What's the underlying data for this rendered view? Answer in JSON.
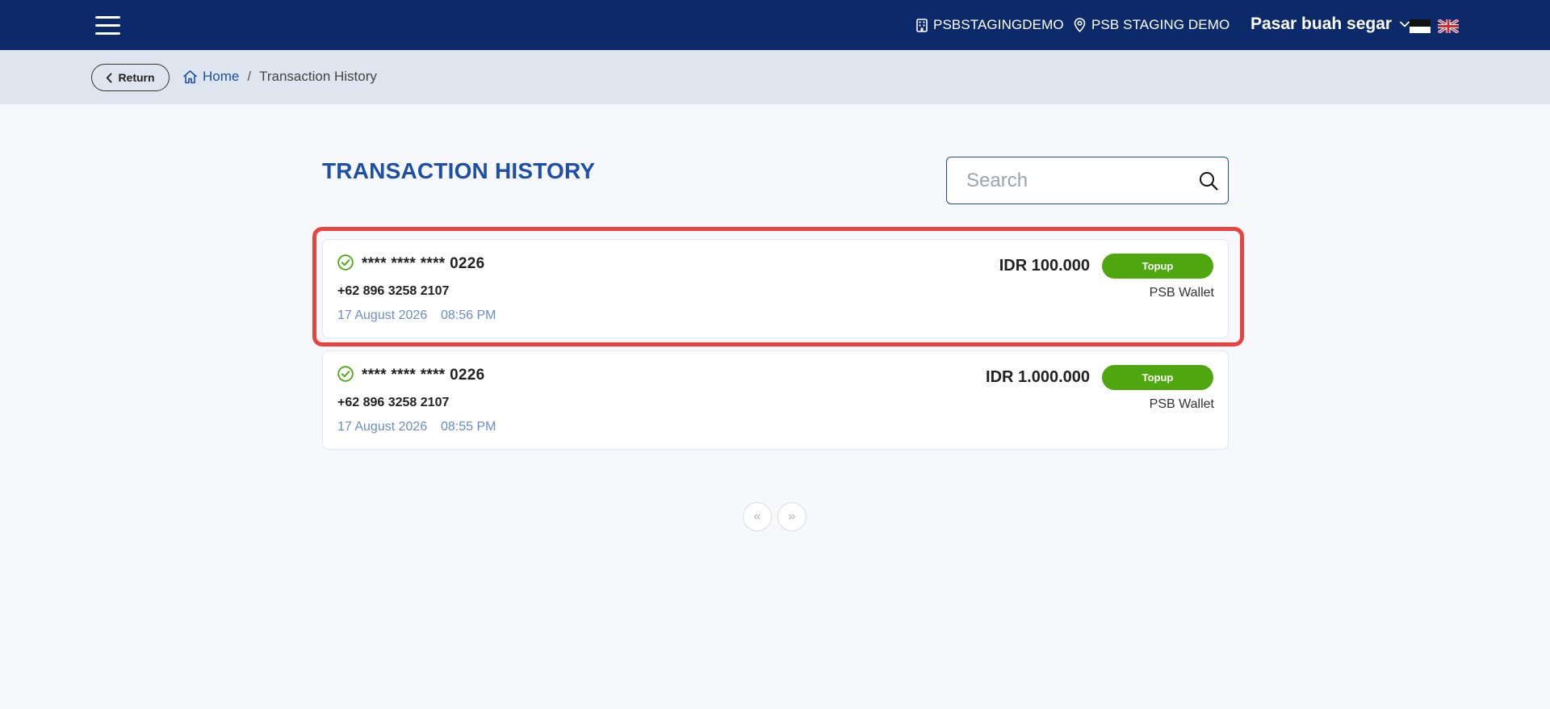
{
  "navbar": {
    "merchant": "PSBSTAGINGDEMO",
    "location": "PSB STAGING DEMO",
    "user": "Pasar buah segar"
  },
  "breadcrumb": {
    "return_label": "Return",
    "home": "Home",
    "separator": "/",
    "current": "Transaction History"
  },
  "page": {
    "title": "TRANSACTION HISTORY"
  },
  "search": {
    "placeholder": "Search",
    "value": ""
  },
  "transactions": [
    {
      "card_number": "**** **** **** 0226",
      "phone": "+62 896 3258 2107",
      "date": "17 August 2026",
      "time": "08:56 PM",
      "amount": "IDR 100.000",
      "type": "Topup",
      "wallet": "PSB Wallet"
    },
    {
      "card_number": "**** **** **** 0226",
      "phone": "+62 896 3258 2107",
      "date": "17 August 2026",
      "time": "08:55 PM",
      "amount": "IDR 1.000.000",
      "type": "Topup",
      "wallet": "PSB Wallet"
    }
  ],
  "pagination": {
    "prev": "«",
    "next": "»"
  },
  "colors": {
    "navbar": "#0c2a69",
    "accent": "#1e4fa8",
    "success": "#4ea70f",
    "highlight": "#e8433f"
  },
  "icons": {
    "menu": "hamburger-menu-icon",
    "merchant": "building-icon",
    "location": "map-pin-icon",
    "dropdown": "chevron-down-icon",
    "back": "chevron-left-icon",
    "home": "home-icon",
    "search": "search-icon",
    "status": "check-circle-icon"
  }
}
